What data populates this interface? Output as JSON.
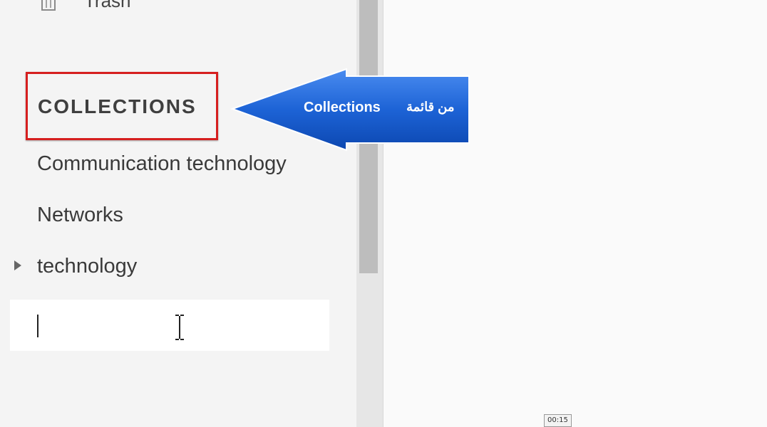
{
  "sidebar": {
    "trash": {
      "label": "Trash",
      "icon": "trash-icon"
    },
    "collections_heading": "COLLECTIONS",
    "items": [
      {
        "label": "Communication technology"
      },
      {
        "label": "Networks"
      },
      {
        "label": "technology",
        "expandable": true,
        "icon": "triangle-right-icon"
      }
    ],
    "new_collection_input": {
      "value": "",
      "placeholder": ""
    }
  },
  "annotation": {
    "label_en": "Collections",
    "label_ar": "من قائمة",
    "arrow_color": "#1560d0",
    "highlight_color": "#d61f1f"
  },
  "video": {
    "timestamp": "00:15"
  }
}
